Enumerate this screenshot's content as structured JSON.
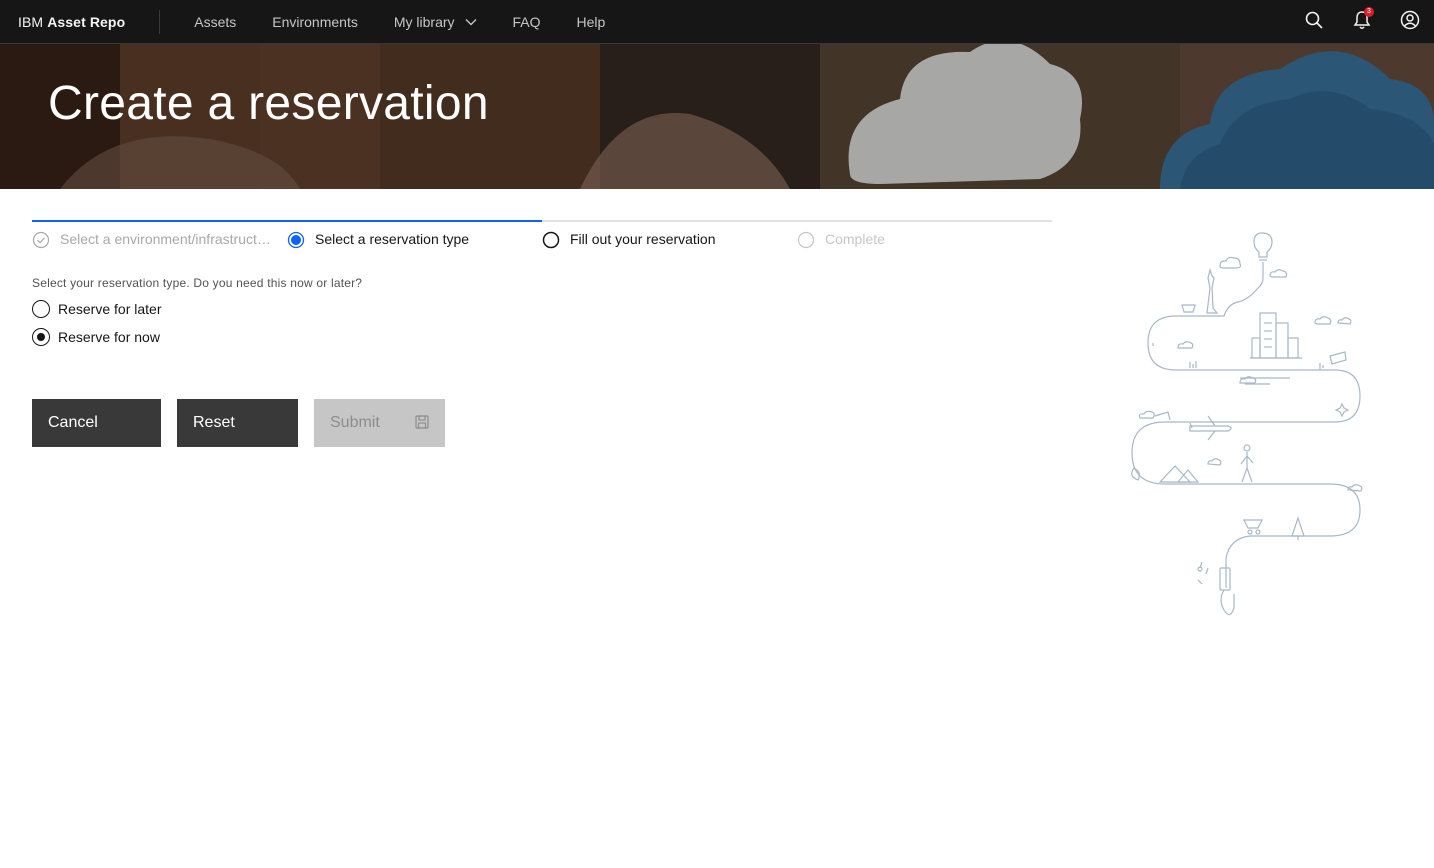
{
  "header": {
    "brand_prefix": "IBM",
    "brand_name": "Asset Repo",
    "nav": [
      {
        "label": "Assets"
      },
      {
        "label": "Environments"
      },
      {
        "label": "My library",
        "has_dropdown": true
      },
      {
        "label": "FAQ"
      },
      {
        "label": "Help"
      }
    ],
    "actions": {
      "search_icon": "search-icon",
      "notification_icon": "notification-icon",
      "notification_count": "3",
      "user_icon": "user-avatar-icon"
    }
  },
  "banner": {
    "title": "Create a reservation"
  },
  "progress": {
    "steps": [
      {
        "label": "Select a environment/infrastructu...",
        "state": "complete"
      },
      {
        "label": "Select a reservation type",
        "state": "current"
      },
      {
        "label": "Fill out your reservation",
        "state": "incomplete"
      },
      {
        "label": "Complete",
        "state": "disabled"
      }
    ]
  },
  "form": {
    "question": "Select your reservation type. Do you need this now or later?",
    "options": [
      {
        "label": "Reserve for later",
        "checked": false
      },
      {
        "label": "Reserve for now",
        "checked": true
      }
    ]
  },
  "buttons": {
    "cancel": "Cancel",
    "reset": "Reset",
    "submit": "Submit",
    "submit_icon": "save-icon"
  },
  "colors": {
    "header_bg": "#161616",
    "progress_active": "#0f62fe",
    "button_dark": "#393939",
    "button_disabled": "#c6c6c6",
    "badge": "#da1e28",
    "illustration_stroke": "#a8b8c8"
  }
}
